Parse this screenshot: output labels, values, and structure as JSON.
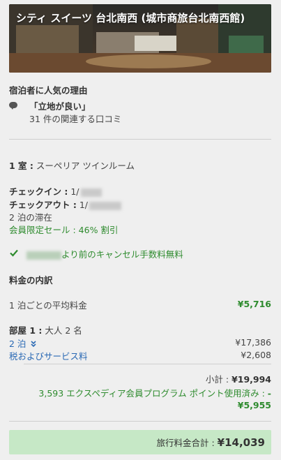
{
  "hotel": {
    "title": "シティ スイーツ 台北南西 (城市商旅台北南西館)"
  },
  "popular": {
    "heading": "宿泊者に人気の理由",
    "reason": "「立地が良い」",
    "reviews": "31 件の関連する口コミ"
  },
  "booking": {
    "rooms_label": "1 室 :",
    "room_type": "スーペリア ツインルーム",
    "checkin_label": "チェックイン :",
    "checkin_value": "1/",
    "checkout_label": "チェックアウト :",
    "checkout_value": "1/",
    "nights": "2 泊の滞在",
    "sale": "会員限定セール : 46% 割引",
    "cancel_text": "より前のキャンセル手数料無料"
  },
  "breakdown": {
    "heading": "料金の内訳",
    "avg_label": "1 泊ごとの平均料金",
    "avg_value": "¥5,716",
    "room_label": "部屋 1 :",
    "room_guests": "大人 2 名",
    "nights_link": "2 泊",
    "nights_value": "¥17,386",
    "tax_link": "税およびサービス料",
    "tax_value": "¥2,608",
    "subtotal_label": "小計 :",
    "subtotal_value": "¥19,994",
    "points_text": "3,593 エクスペディア会員プログラム ポイント使用済み :",
    "points_dash": "-",
    "points_value": "¥5,955",
    "total_label": "旅行料金合計 :",
    "total_value": "¥14,039"
  },
  "icons": [
    "speech-bubble-icon",
    "checkmark-icon",
    "chevron-double-down-icon"
  ],
  "colors": {
    "green": "#2e8b2e",
    "link": "#2a69b4",
    "total_bg": "#c6e8c6"
  }
}
